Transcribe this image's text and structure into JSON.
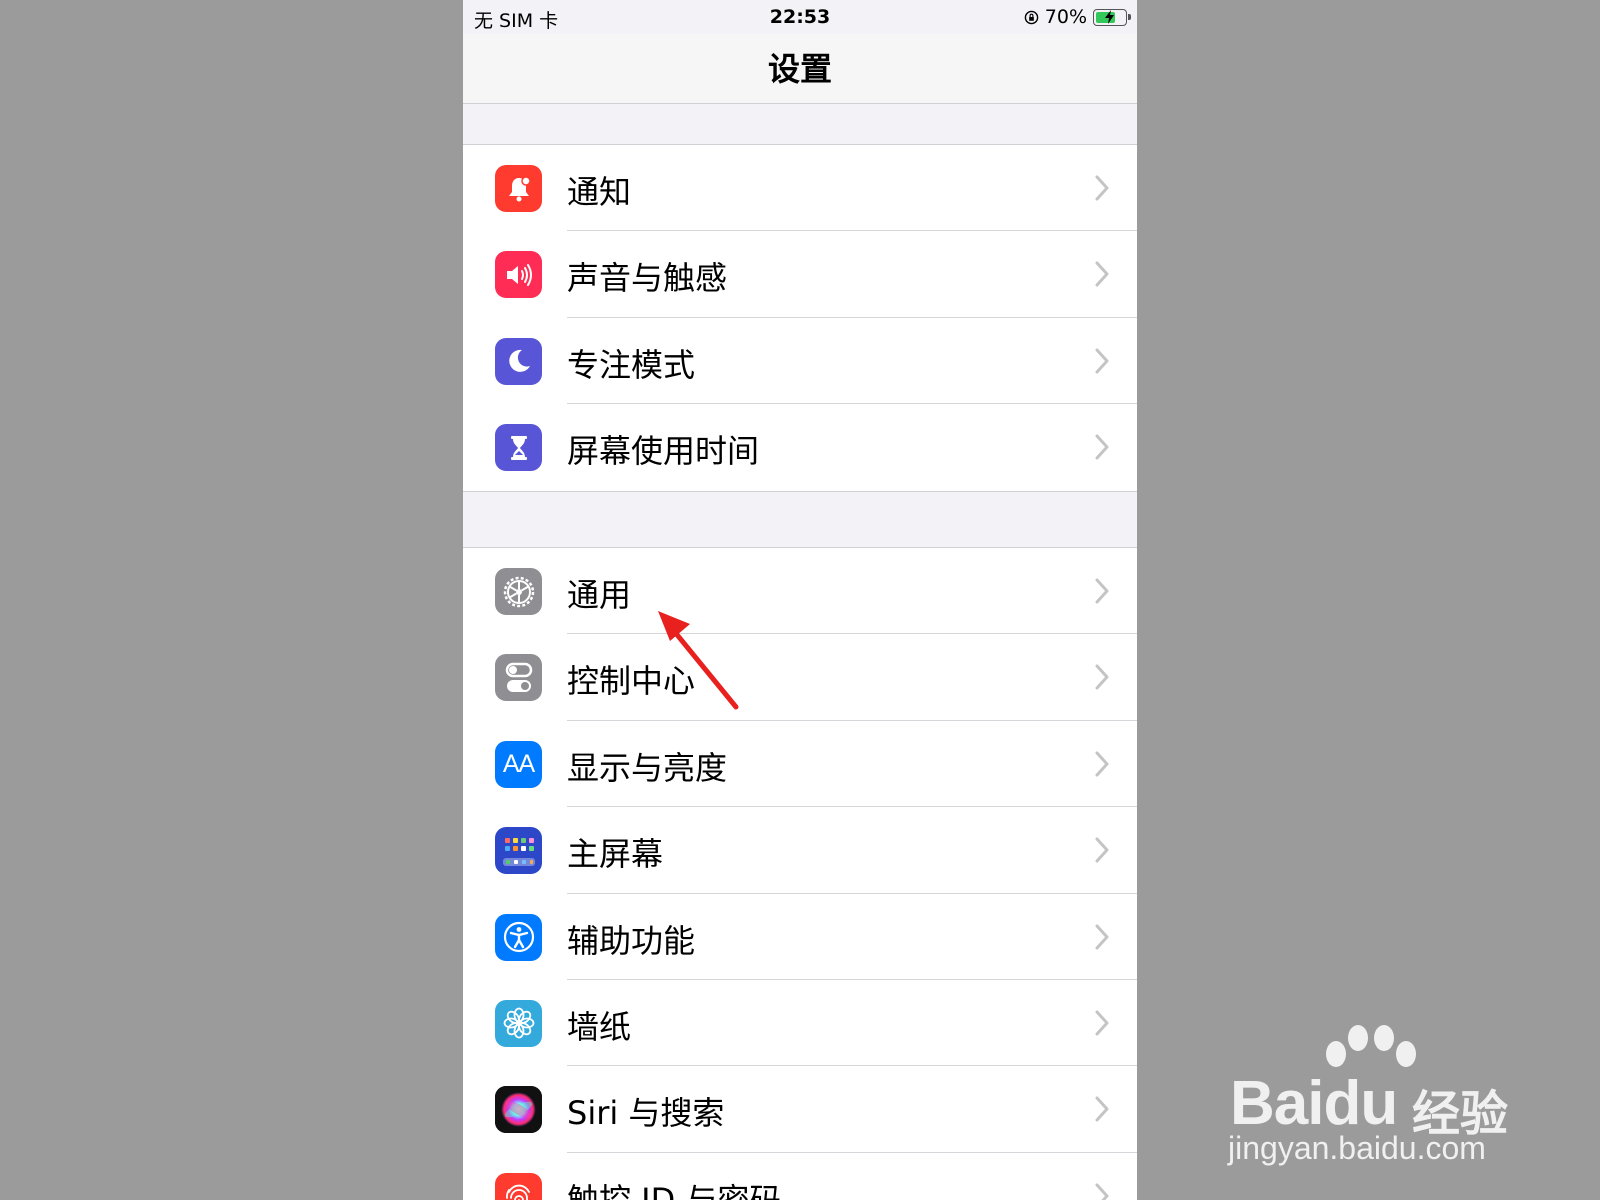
{
  "status_bar": {
    "carrier": "无 SIM 卡",
    "time": "22:53",
    "battery": "70%",
    "battery_level": 0.7
  },
  "nav": {
    "title": "设置"
  },
  "groups": [
    {
      "items": [
        {
          "label": "通知",
          "icon": "notification-bell-icon",
          "color": "#ff3b30"
        },
        {
          "label": "声音与触感",
          "icon": "speaker-icon",
          "color": "#ff2d55"
        },
        {
          "label": "专注模式",
          "icon": "moon-icon",
          "color": "#5856d6"
        },
        {
          "label": "屏幕使用时间",
          "icon": "hourglass-icon",
          "color": "#5856d6"
        }
      ]
    },
    {
      "items": [
        {
          "label": "通用",
          "icon": "gear-icon",
          "color": "#8e8e93"
        },
        {
          "label": "控制中心",
          "icon": "toggles-icon",
          "color": "#8e8e93"
        },
        {
          "label": "显示与亮度",
          "icon": "text-size-icon",
          "color": "#007aff",
          "glyph": "AA"
        },
        {
          "label": "主屏幕",
          "icon": "home-screen-grid-icon",
          "color": "#2c48c8"
        },
        {
          "label": "辅助功能",
          "icon": "accessibility-icon",
          "color": "#007aff"
        },
        {
          "label": "墙纸",
          "icon": "flower-icon",
          "color": "#34aadc"
        },
        {
          "label": "Siri 与搜索",
          "icon": "siri-icon",
          "color": "#1c1c3a"
        },
        {
          "label": "触控 ID 与密码",
          "icon": "fingerprint-icon",
          "color": "#ff3b30"
        }
      ]
    }
  ],
  "watermark": {
    "brand": "Baidu",
    "brand_cn": "经验",
    "site": "jingyan.baidu.com"
  },
  "colors": {
    "annotation_arrow": "#e8211e",
    "chevron": "#c4c4c7"
  }
}
